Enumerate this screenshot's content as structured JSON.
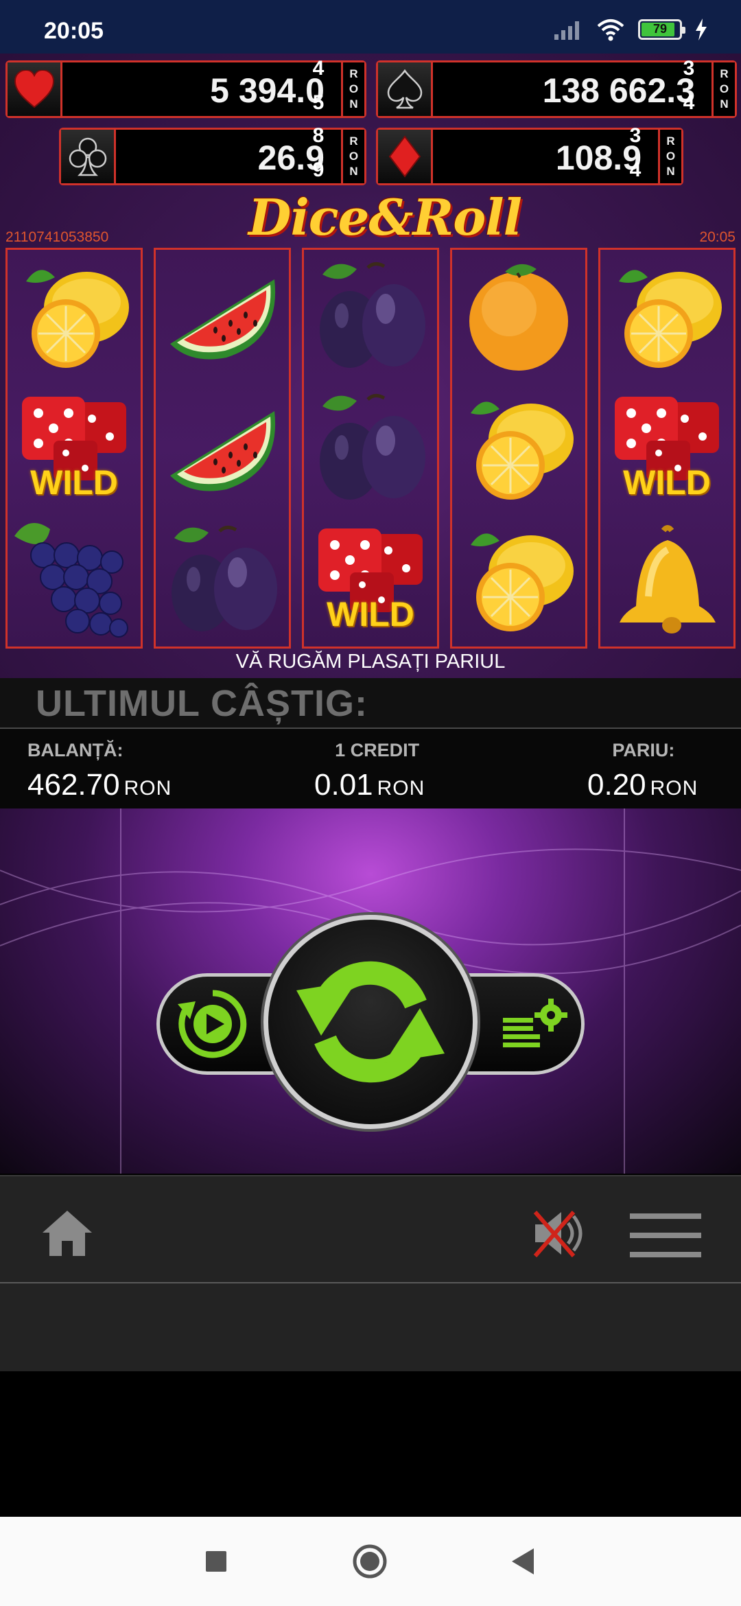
{
  "status_bar": {
    "time": "20:05",
    "battery": "79",
    "icons": [
      "signal-icon",
      "wifi-icon",
      "battery-icon",
      "charging-icon"
    ]
  },
  "jackpots": [
    {
      "suit": "heart",
      "value": "5 394.0",
      "roll": [
        "4",
        "5"
      ],
      "unit": [
        "R",
        "O",
        "N"
      ],
      "color": "#e02020"
    },
    {
      "suit": "spade",
      "value": "138 662.3",
      "roll": [
        "3",
        "4"
      ],
      "unit": [
        "R",
        "O",
        "N"
      ],
      "color": "#1a1a1a"
    },
    {
      "suit": "club",
      "value": "26.9",
      "roll": [
        "8",
        "9"
      ],
      "unit": [
        "R",
        "O",
        "N"
      ],
      "color": "#1a1a1a"
    },
    {
      "suit": "diamond",
      "value": "108.9",
      "roll": [
        "3",
        "4"
      ],
      "unit": [
        "R",
        "O",
        "N"
      ],
      "color": "#e02020"
    }
  ],
  "game": {
    "logo": "Dice&Roll",
    "id": "2110741053850",
    "clock": "20:05",
    "wild_label": "WILD",
    "reels": [
      [
        "lemon",
        "dice-wild",
        "grapes"
      ],
      [
        "watermelon",
        "watermelon",
        "plum"
      ],
      [
        "plum",
        "plum",
        "dice-wild"
      ],
      [
        "orange",
        "lemon",
        "lemon"
      ],
      [
        "lemon",
        "dice-wild",
        "bell"
      ]
    ],
    "message": "VĂ RUGĂM PLASAȚI PARIUL"
  },
  "info": {
    "last_win_label": "ULTIMUL CÂȘTIG:",
    "balance_label": "BALANȚĂ:",
    "balance_value": "462.70",
    "credit_label": "1 CREDIT",
    "credit_value": "0.01",
    "bet_label": "PARIU:",
    "bet_value": "0.20",
    "currency": "RON"
  },
  "controls": {
    "accent": "#7ed321"
  }
}
